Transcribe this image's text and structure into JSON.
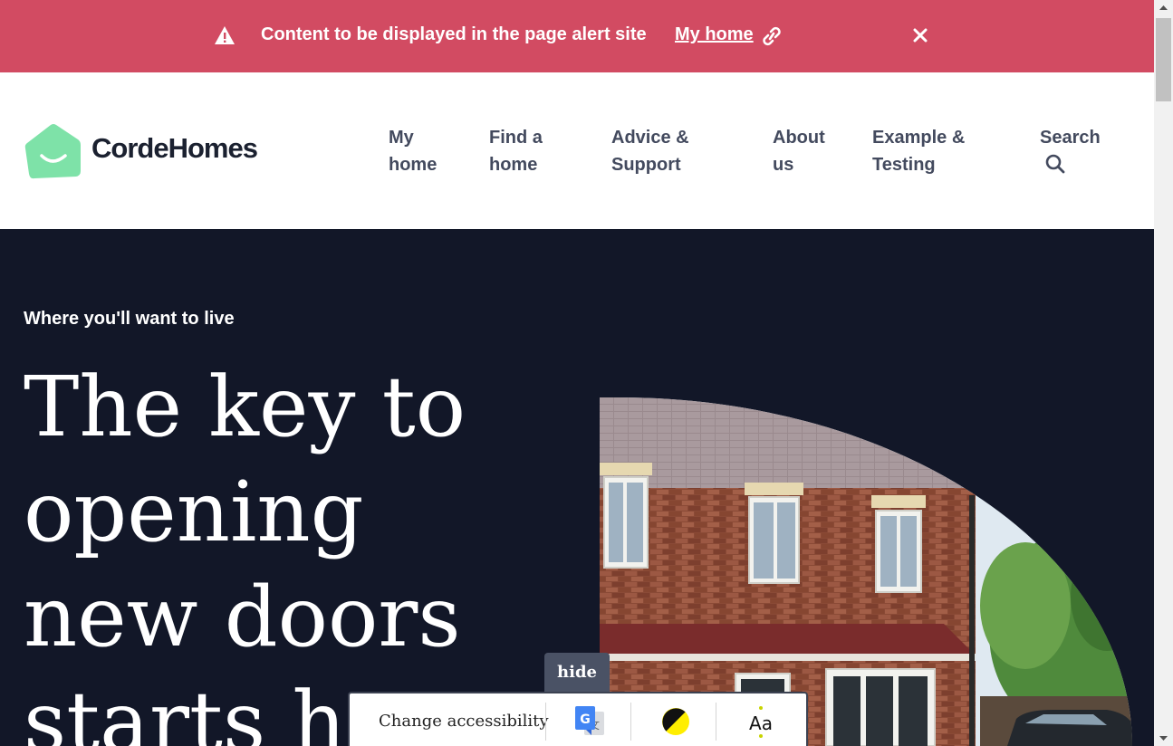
{
  "alert": {
    "message": "Content to be displayed in the page alert site",
    "link_text": "My home",
    "color": "#d24b62"
  },
  "brand": {
    "name": "CordeHomes",
    "mark_color": "#7ee2a8"
  },
  "nav": {
    "items": [
      {
        "line1": "My",
        "line2": "home"
      },
      {
        "line1": "Find a",
        "line2": "home"
      },
      {
        "line1": "Advice &",
        "line2": "Support"
      },
      {
        "line1": "About",
        "line2": "us"
      },
      {
        "line1": "Example &",
        "line2": "Testing"
      },
      {
        "line1": "Search",
        "line2": ""
      }
    ]
  },
  "hero": {
    "eyebrow": "Where you'll want to live",
    "headline": [
      "The key to",
      "opening",
      "new doors",
      "starts here"
    ],
    "background": "#121728"
  },
  "accessibility": {
    "hide_label": "hide",
    "label": "Change accessibility",
    "tools": [
      "google-translate-icon",
      "contrast-icon",
      "text-size-icon"
    ],
    "text_size_glyph": "Aa"
  },
  "icons": {
    "alert": "warning-icon",
    "link": "link-icon",
    "close": "close-icon",
    "search": "search-icon"
  }
}
